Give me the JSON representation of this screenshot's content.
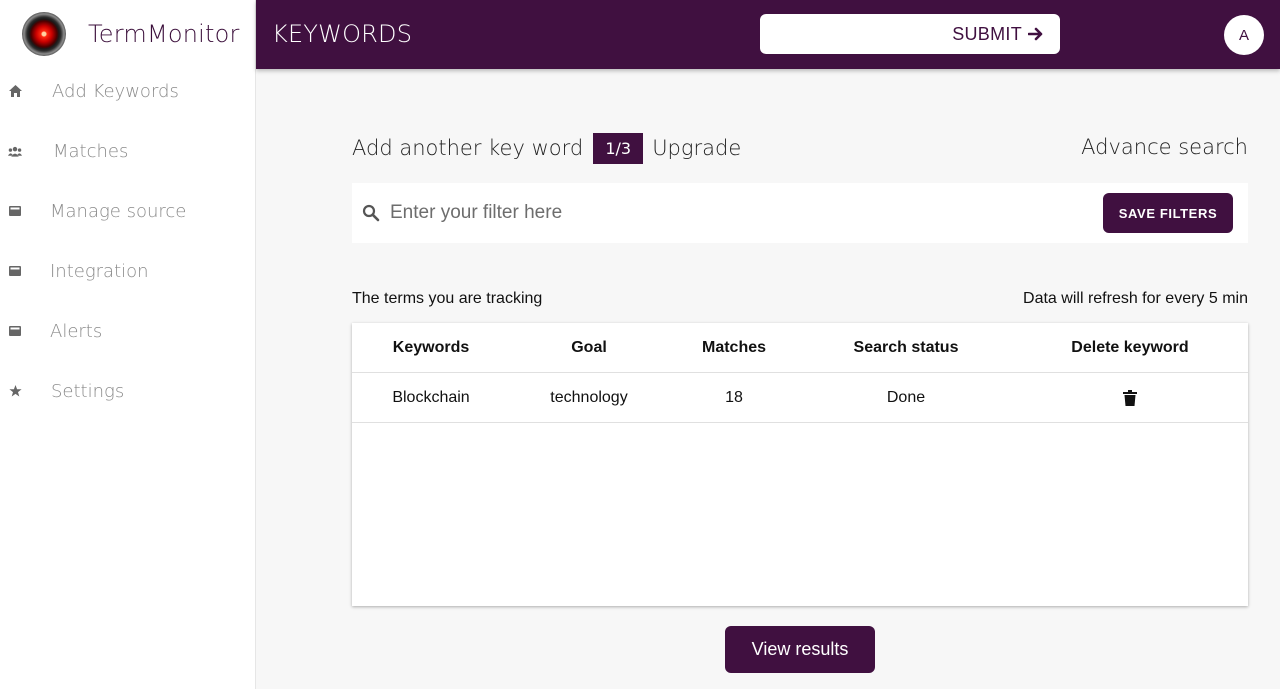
{
  "brand": {
    "name": "TermMonitor"
  },
  "sidebar": {
    "items": [
      {
        "label": "Add Keywords",
        "icon": "home-icon"
      },
      {
        "label": "Matches",
        "icon": "users-icon"
      },
      {
        "label": "Manage source",
        "icon": "card-icon"
      },
      {
        "label": "Integration",
        "icon": "card-icon"
      },
      {
        "label": "Alerts",
        "icon": "card-icon"
      },
      {
        "label": "Settings",
        "icon": "star-icon"
      }
    ]
  },
  "header": {
    "title": "KEYWORDS",
    "submit_label": "SUBMIT",
    "avatar_initial": "A"
  },
  "main": {
    "add_another_label": "Add another key word",
    "quota": "1/3",
    "upgrade_label": "Upgrade",
    "advance_search_label": "Advance search",
    "filter_placeholder": "Enter your filter here",
    "save_filters_label": "SAVE FILTERS",
    "tracking_label": "The terms you are tracking",
    "refresh_label": "Data will refresh for every 5 min",
    "view_results_label": "View results"
  },
  "table": {
    "columns": [
      "Keywords",
      "Goal",
      "Matches",
      "Search status",
      "Delete keyword"
    ],
    "rows": [
      {
        "keyword": "Blockchain",
        "goal": "technology",
        "matches": "18",
        "status": "Done"
      }
    ]
  },
  "colors": {
    "primary": "#401040",
    "background": "#f7f7f7",
    "sidebar_text": "#8a8a8a"
  }
}
